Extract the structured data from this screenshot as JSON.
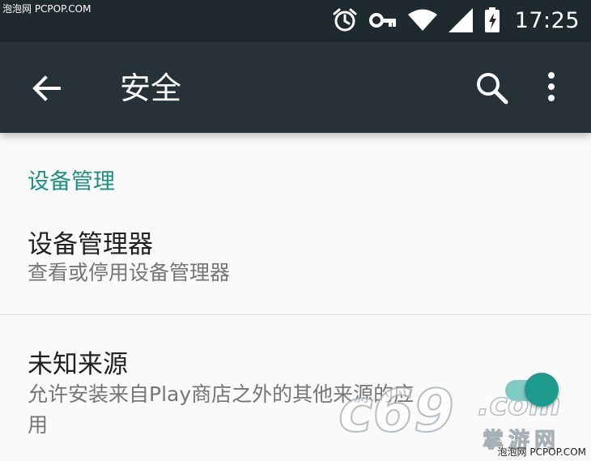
{
  "watermark": {
    "top": "泡泡网 PCPOP.COM",
    "bottom": "泡泡网 PCPOP.COM"
  },
  "status_bar": {
    "time": "17:25",
    "icons": [
      "alarm-icon",
      "key-icon",
      "wifi-icon",
      "signal-icon",
      "battery-charging-icon"
    ]
  },
  "app_bar": {
    "title": "安全",
    "back_icon": "arrow-back-icon",
    "search_icon": "search-icon",
    "more_icon": "more-vert-icon"
  },
  "section": {
    "header": "设备管理"
  },
  "prefs": [
    {
      "title": "设备管理器",
      "summary": "查看或停用设备管理器"
    },
    {
      "title": "未知来源",
      "summary_line1": "允许安装来自Play商店之外的其他来源的应",
      "summary_line2": "用",
      "switch_on": true
    }
  ],
  "logo": {
    "domain": "c69.com",
    "name": "掌游网"
  },
  "colors": {
    "status_bar": "#1f2a2e",
    "app_bar": "#263238",
    "accent": "#1e8f82",
    "switch_track": "#80cbc4",
    "switch_thumb": "#1e9a8c"
  }
}
